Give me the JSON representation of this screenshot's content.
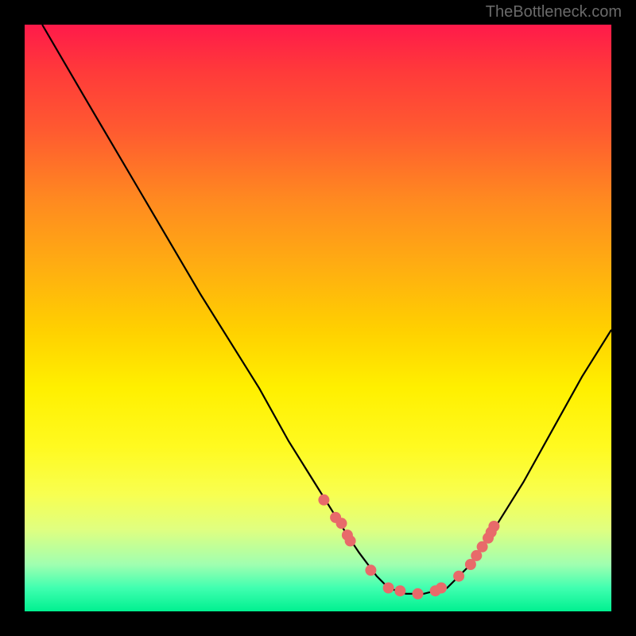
{
  "watermark": "TheBottleneck.com",
  "chart_data": {
    "type": "line",
    "title": "",
    "xlabel": "",
    "ylabel": "",
    "xlim": [
      0,
      100
    ],
    "ylim": [
      0,
      100
    ],
    "curve": {
      "name": "bottleneck-curve",
      "x": [
        3,
        10,
        20,
        30,
        40,
        45,
        50,
        55,
        57,
        60,
        62,
        65,
        68,
        72,
        76,
        80,
        85,
        90,
        95,
        100
      ],
      "y": [
        100,
        88,
        71,
        54,
        38,
        29,
        21,
        13,
        10,
        6,
        4,
        3,
        3,
        4,
        8,
        14,
        22,
        31,
        40,
        48
      ]
    },
    "markers": {
      "name": "highlight-points",
      "color": "#e86a6a",
      "x": [
        51,
        53,
        54,
        55,
        55.5,
        59,
        62,
        64,
        67,
        70,
        71,
        74,
        76,
        77,
        78,
        79,
        79.5,
        80
      ],
      "y": [
        19,
        16,
        15,
        13,
        12,
        7,
        4,
        3.5,
        3,
        3.5,
        4,
        6,
        8,
        9.5,
        11,
        12.5,
        13.5,
        14.5
      ]
    }
  }
}
